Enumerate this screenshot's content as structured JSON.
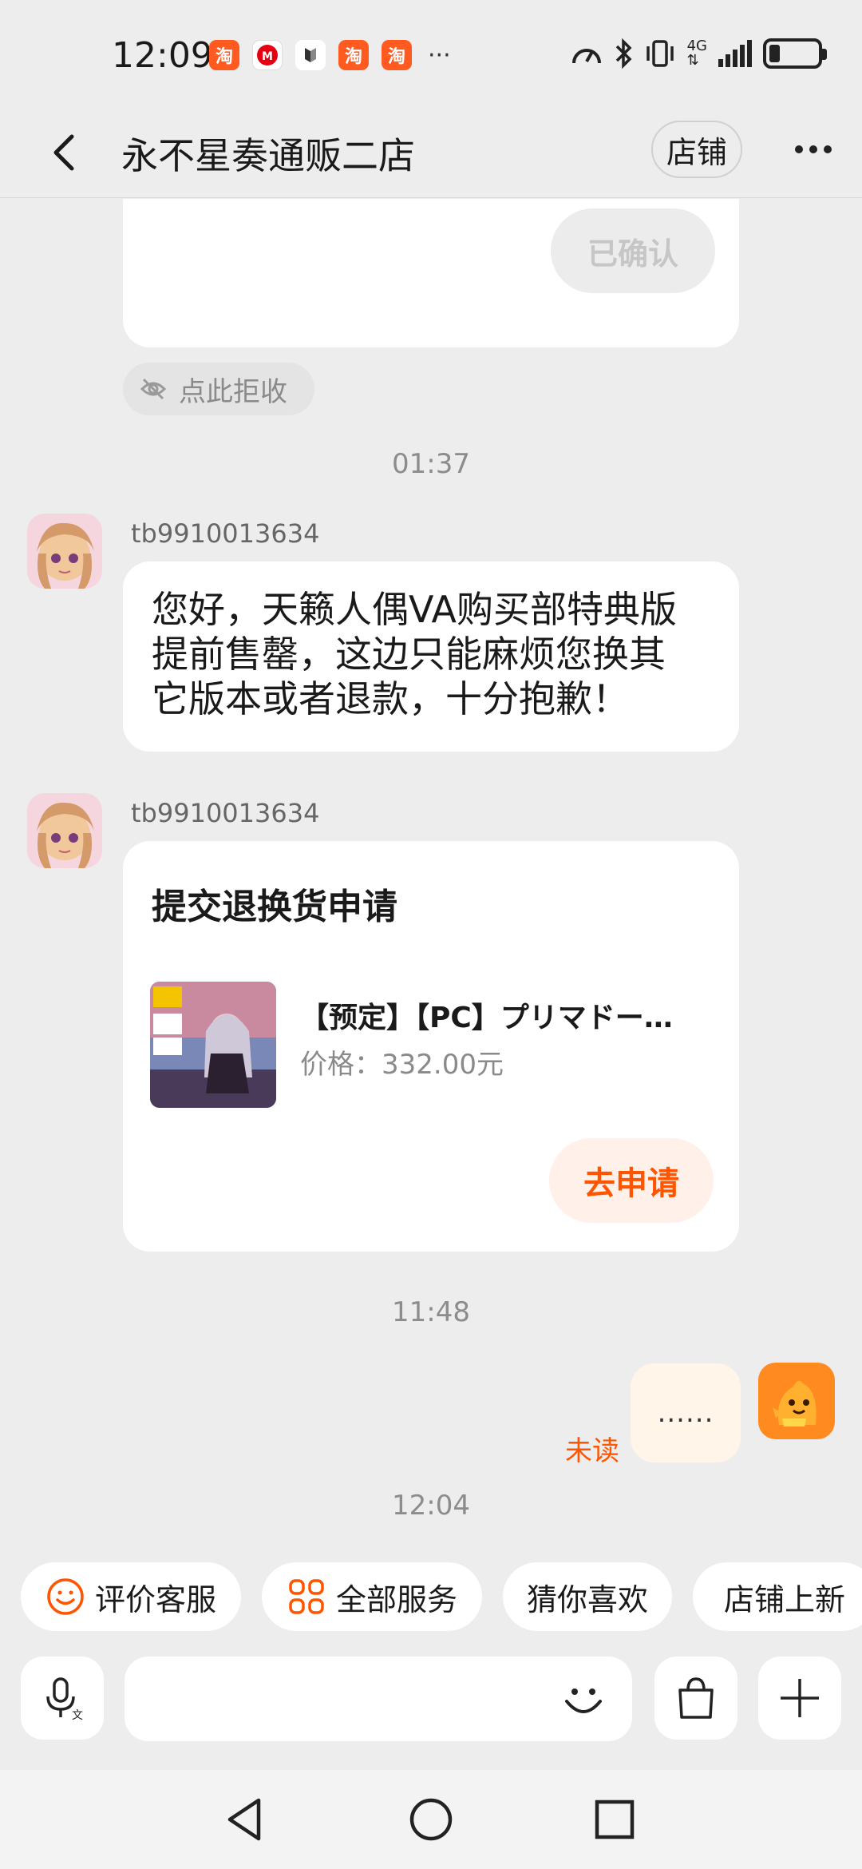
{
  "status_bar": {
    "time": "12:09",
    "app_badges": [
      "淘",
      "淘",
      "淘"
    ],
    "more_indicator": "···",
    "network_label_top": "4G",
    "network_label_bottom": "⇅",
    "icons": [
      "taobao-icon",
      "station-icon",
      "hm-icon",
      "taobao-icon",
      "taobao-icon",
      "speed-icon",
      "bluetooth-icon",
      "vibrate-icon",
      "signal-icon",
      "battery-icon"
    ],
    "battery_level": 0.22
  },
  "header": {
    "title": "永不星奏通贩二店",
    "shop_button": "店铺"
  },
  "chat": {
    "confirm_card": {
      "button_label": "已确认"
    },
    "reject_chip": {
      "label": "点此拒收"
    },
    "timestamps": [
      "01:37",
      "11:48",
      "12:04"
    ],
    "messages": [
      {
        "sender": "tb9910013634",
        "text": "您好，天籁人偶VA购买部特典版提前售罄，这边只能麻烦您换其它版本或者退款，十分抱歉！"
      },
      {
        "sender": "tb9910013634",
        "card": {
          "title": "提交退换货申请",
          "product_name": "【预定】【PC】プリマドー...",
          "price": "价格：332.00元",
          "button": "去申请"
        }
      }
    ],
    "my_message": {
      "text": "......",
      "status": "未读"
    }
  },
  "quick_chips": [
    {
      "label": "评价客服",
      "icon": "smile-icon"
    },
    {
      "label": "全部服务",
      "icon": "services-grid-icon"
    },
    {
      "label": "猜你喜欢",
      "icon": ""
    },
    {
      "label": "店铺上新",
      "icon": ""
    }
  ],
  "input_bar": {
    "placeholder": "",
    "icons": [
      "voice-translate-icon",
      "emoji-icon",
      "shopping-bag-icon",
      "plus-icon"
    ]
  },
  "nav_bar": {
    "icons": [
      "nav-back-icon",
      "nav-home-icon",
      "nav-recents-icon"
    ]
  },
  "colors": {
    "accent": "#ff5500",
    "background": "#ededed",
    "bubble": "#ffffff",
    "my_bubble": "#fff5e8"
  }
}
